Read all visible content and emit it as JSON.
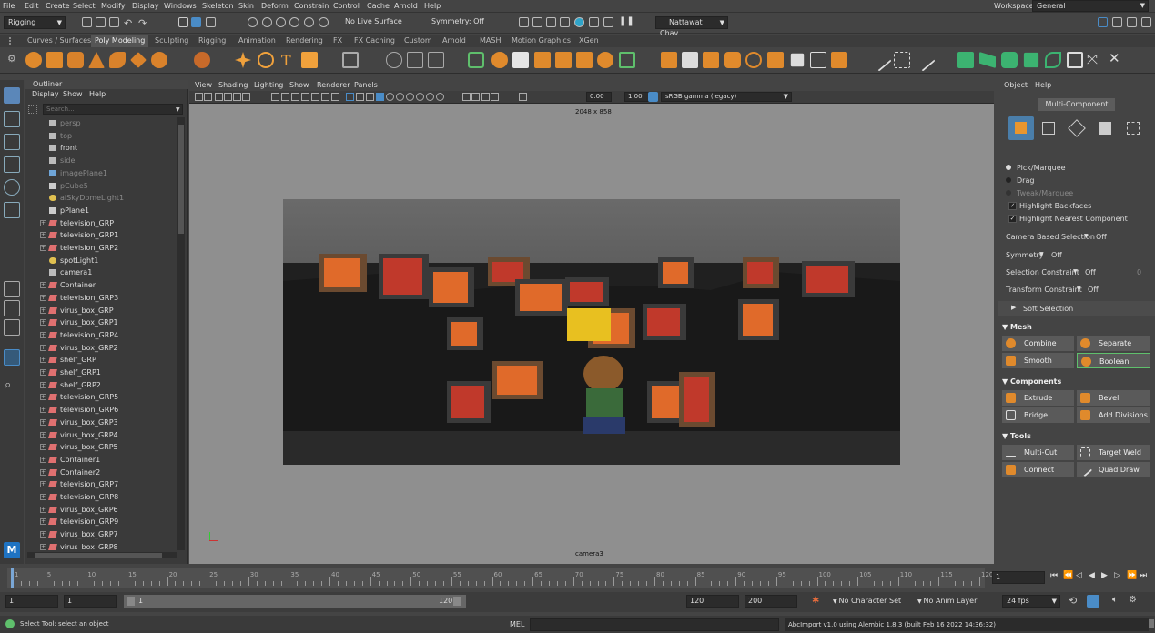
{
  "menubar": {
    "items": [
      "File",
      "Edit",
      "Create",
      "Select",
      "Modify",
      "Display",
      "Windows",
      "Skeleton",
      "Skin",
      "Deform",
      "Constrain",
      "Control",
      "Cache",
      "Arnold",
      "Help"
    ],
    "workspace_label": "Workspace:",
    "workspace_value": "General"
  },
  "statusline": {
    "mode": "Rigging",
    "live_surface": "No Live Surface",
    "symmetry": "Symmetry: Off",
    "user": "Nattawat Chav..."
  },
  "shelf": {
    "tabs": [
      "Curves / Surfaces",
      "Poly Modeling",
      "Sculpting",
      "Rigging",
      "Animation",
      "Rendering",
      "FX",
      "FX Caching",
      "Custom",
      "Arnold",
      "MASH",
      "Motion Graphics",
      "XGen"
    ],
    "active_tab": "Poly Modeling"
  },
  "outliner": {
    "title": "Outliner",
    "menu": [
      "Display",
      "Show",
      "Help"
    ],
    "search_placeholder": "Search...",
    "items": [
      {
        "name": "persp",
        "type": "camera",
        "dim": true,
        "expand": false
      },
      {
        "name": "top",
        "type": "camera",
        "dim": true,
        "expand": false
      },
      {
        "name": "front",
        "type": "camera",
        "dim": false,
        "expand": false
      },
      {
        "name": "side",
        "type": "camera",
        "dim": true,
        "expand": false
      },
      {
        "name": "imagePlane1",
        "type": "image",
        "dim": true,
        "expand": false
      },
      {
        "name": "pCube5",
        "type": "transform",
        "dim": true,
        "expand": false
      },
      {
        "name": "aiSkyDomeLight1",
        "type": "light",
        "dim": true,
        "expand": false
      },
      {
        "name": "pPlane1",
        "type": "transform",
        "dim": false,
        "expand": false
      },
      {
        "name": "television_GRP",
        "type": "group",
        "dim": false,
        "expand": true
      },
      {
        "name": "television_GRP1",
        "type": "group",
        "dim": false,
        "expand": true
      },
      {
        "name": "television_GRP2",
        "type": "group",
        "dim": false,
        "expand": true
      },
      {
        "name": "spotLight1",
        "type": "light",
        "dim": false,
        "expand": false
      },
      {
        "name": "camera1",
        "type": "camera",
        "dim": false,
        "expand": false
      },
      {
        "name": "Container",
        "type": "group",
        "dim": false,
        "expand": true
      },
      {
        "name": "television_GRP3",
        "type": "group",
        "dim": false,
        "expand": true
      },
      {
        "name": "virus_box_GRP",
        "type": "group",
        "dim": false,
        "expand": true
      },
      {
        "name": "virus_box_GRP1",
        "type": "group",
        "dim": false,
        "expand": true
      },
      {
        "name": "television_GRP4",
        "type": "group",
        "dim": false,
        "expand": true
      },
      {
        "name": "virus_box_GRP2",
        "type": "group",
        "dim": false,
        "expand": true
      },
      {
        "name": "shelf_GRP",
        "type": "group",
        "dim": false,
        "expand": true
      },
      {
        "name": "shelf_GRP1",
        "type": "group",
        "dim": false,
        "expand": true
      },
      {
        "name": "shelf_GRP2",
        "type": "group",
        "dim": false,
        "expand": true
      },
      {
        "name": "television_GRP5",
        "type": "group",
        "dim": false,
        "expand": true
      },
      {
        "name": "television_GRP6",
        "type": "group",
        "dim": false,
        "expand": true
      },
      {
        "name": "virus_box_GRP3",
        "type": "group",
        "dim": false,
        "expand": true
      },
      {
        "name": "virus_box_GRP4",
        "type": "group",
        "dim": false,
        "expand": true
      },
      {
        "name": "virus_box_GRP5",
        "type": "group",
        "dim": false,
        "expand": true
      },
      {
        "name": "Container1",
        "type": "group",
        "dim": false,
        "expand": true
      },
      {
        "name": "Container2",
        "type": "group",
        "dim": false,
        "expand": true
      },
      {
        "name": "television_GRP7",
        "type": "group",
        "dim": false,
        "expand": true
      },
      {
        "name": "television_GRP8",
        "type": "group",
        "dim": false,
        "expand": true
      },
      {
        "name": "virus_box_GRP6",
        "type": "group",
        "dim": false,
        "expand": true
      },
      {
        "name": "television_GRP9",
        "type": "group",
        "dim": false,
        "expand": true
      },
      {
        "name": "virus_box_GRP7",
        "type": "group",
        "dim": false,
        "expand": true
      },
      {
        "name": "virus_box_GRP8",
        "type": "group",
        "dim": false,
        "expand": true
      }
    ]
  },
  "viewport": {
    "menu": [
      "View",
      "Shading",
      "Lighting",
      "Show",
      "Renderer",
      "Panels"
    ],
    "field_value_1": "0.00",
    "field_value_2": "1.00",
    "color_space": "sRGB gamma (legacy)",
    "resolution_label": "2048 x 858",
    "camera_label": "camera3"
  },
  "attr": {
    "menu": [
      "Object",
      "Help"
    ],
    "mode_button": "Multi-Component",
    "radio": [
      "Pick/Marquee",
      "Drag",
      "Tweak/Marquee"
    ],
    "checks": [
      "Highlight Backfaces",
      "Highlight Nearest Component"
    ],
    "camera_based_label": "Camera Based Selection",
    "camera_based_value": "Off",
    "symmetry_label": "Symmetry",
    "symmetry_value": "Off",
    "selection_constraint_label": "Selection Constraint",
    "selection_constraint_value": "Off",
    "selection_constraint_num": "0",
    "transform_constraint_label": "Transform Constraint",
    "transform_constraint_value": "Off",
    "soft_selection": "Soft Selection",
    "mesh_header": "Mesh",
    "mesh_buttons": [
      "Combine",
      "Separate",
      "Smooth",
      "Boolean"
    ],
    "components_header": "Components",
    "component_buttons": [
      "Extrude",
      "Bevel",
      "Bridge",
      "Add Divisions"
    ],
    "tools_header": "Tools",
    "tool_buttons": [
      "Multi-Cut",
      "Target Weld",
      "Connect",
      "Quad Draw"
    ]
  },
  "timeslider": {
    "labels": [
      "1",
      "5",
      "10",
      "15",
      "20",
      "25",
      "30",
      "35",
      "40",
      "45",
      "50",
      "55",
      "60",
      "65",
      "70",
      "75",
      "80",
      "85",
      "90",
      "95",
      "100",
      "105",
      "110",
      "115",
      "120"
    ],
    "current_frame": "1"
  },
  "range": {
    "start": "1",
    "start2": "1",
    "slider_start": "1",
    "slider_end": "120",
    "end": "120",
    "end2": "200",
    "character_set": "No Character Set",
    "anim_layer": "No Anim Layer",
    "fps": "24 fps"
  },
  "cmdline": {
    "help": "Select Tool: select an object",
    "lang": "MEL",
    "feedback": "AbcImport v1.0 using Alembic 1.8.3 (built Feb 16 2022 14:36:32)"
  },
  "colors": {
    "accent_blue": "#4a8cc7",
    "active_green": "#5fbf6c",
    "render_red": "#c0392b"
  }
}
